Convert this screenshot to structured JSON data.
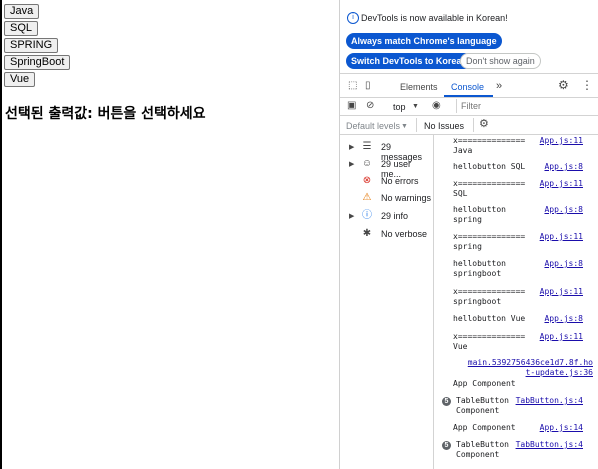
{
  "page": {
    "buttons": [
      "Java",
      "SQL",
      "SPRING",
      "SpringBoot",
      "Vue"
    ],
    "result_text": "선택된 출력값: 버튼을 선택하세요"
  },
  "devtools": {
    "banner": {
      "info_text": "DevTools is now available in Korean!",
      "btn_match": "Always match Chrome's language",
      "btn_switch": "Switch DevTools to Korean",
      "btn_dismiss": "Don't show again"
    },
    "tabs": {
      "elements": "Elements",
      "console": "Console",
      "more": "»"
    },
    "toolbar": {
      "context": "top",
      "filter_placeholder": "Filter",
      "levels": "Default levels",
      "issues": "No Issues"
    },
    "sidebar": [
      {
        "label": "29 messages",
        "icon": "list-icon",
        "arrow": true
      },
      {
        "label": "29 user me...",
        "icon": "user-icon",
        "arrow": true
      },
      {
        "label": "No errors",
        "icon": "error-icon",
        "arrow": false
      },
      {
        "label": "No warnings",
        "icon": "warning-icon",
        "arrow": false
      },
      {
        "label": "29 info",
        "icon": "info-icon",
        "arrow": true
      },
      {
        "label": "No verbose",
        "icon": "bug-icon",
        "arrow": false
      }
    ],
    "logs": [
      {
        "msg": "x==============\nJava",
        "src": "App.js:11"
      },
      {
        "msg": "hellobutton SQL",
        "src": "App.js:8"
      },
      {
        "msg": "x==============\nSQL",
        "src": "App.js:11"
      },
      {
        "msg": "hellobutton\nspring",
        "src": "App.js:8"
      },
      {
        "msg": "x==============\nspring",
        "src": "App.js:11"
      },
      {
        "msg": "hellobutton\nspringboot",
        "src": "App.js:8"
      },
      {
        "msg": "x==============\nspringboot",
        "src": "App.js:11"
      },
      {
        "msg": "hellobutton Vue",
        "src": "App.js:8"
      },
      {
        "msg": "x==============\nVue",
        "src": "App.js:11"
      },
      {
        "msg": "",
        "src": "main.5392756436ce1d7.8f.ho\nt-update.js:36"
      },
      {
        "msg": "App Component",
        "src": ""
      },
      {
        "msg": "TableButton\nComponent",
        "src": "TabButton.js:4",
        "badge": "5"
      },
      {
        "msg": "App Component",
        "src": "App.js:14"
      },
      {
        "msg": "TableButton\nComponent",
        "src": "TabButton.js:4",
        "badge": "5"
      }
    ]
  }
}
